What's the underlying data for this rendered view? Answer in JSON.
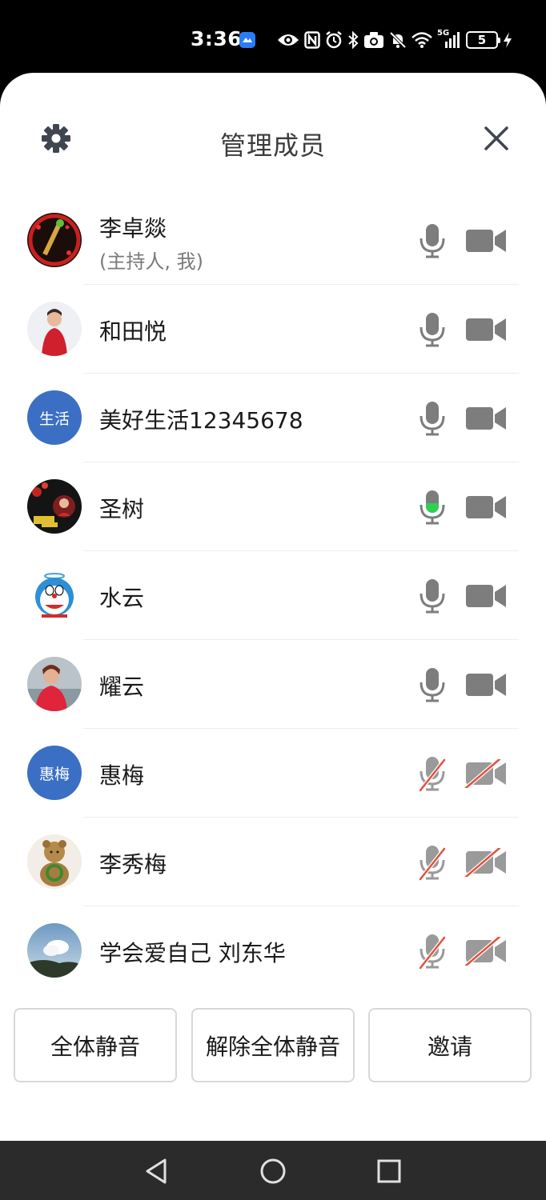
{
  "status_bar": {
    "time": "3:36",
    "network": "5G",
    "battery_level": "5",
    "icons": [
      "app-notification-icon",
      "eye-comfort-icon",
      "nfc-icon",
      "alarm-icon",
      "bluetooth-icon",
      "camera-icon",
      "mute-notification-icon",
      "wifi-icon",
      "signal-icon",
      "battery-icon",
      "charging-icon"
    ]
  },
  "header": {
    "title": "管理成员",
    "left_icon": "gear-icon",
    "right_icon": "close-icon"
  },
  "members": [
    {
      "name": "李卓燚",
      "role": "(主持人, 我)",
      "avatar": "photo",
      "mic": "on",
      "camera": "on"
    },
    {
      "name": "和田悦",
      "role": "",
      "avatar": "photo",
      "mic": "on",
      "camera": "on"
    },
    {
      "name": "美好生活12345678",
      "role": "",
      "avatar": "text",
      "avatar_text": "生活",
      "mic": "on",
      "camera": "on"
    },
    {
      "name": "圣树",
      "role": "",
      "avatar": "photo",
      "mic": "speaking",
      "camera": "on"
    },
    {
      "name": "水云",
      "role": "",
      "avatar": "photo",
      "mic": "on",
      "camera": "on"
    },
    {
      "name": "耀云",
      "role": "",
      "avatar": "photo",
      "mic": "on",
      "camera": "on"
    },
    {
      "name": "惠梅",
      "role": "",
      "avatar": "text",
      "avatar_text": "惠梅",
      "mic": "off",
      "camera": "off"
    },
    {
      "name": "李秀梅",
      "role": "",
      "avatar": "photo",
      "mic": "off",
      "camera": "off"
    },
    {
      "name": "学会爱自己 刘东华",
      "role": "",
      "avatar": "photo",
      "mic": "off",
      "camera": "off"
    }
  ],
  "actions": {
    "mute_all": "全体静音",
    "unmute_all": "解除全体静音",
    "invite": "邀请"
  },
  "nav_bar": {
    "icons": [
      "back-icon",
      "home-icon",
      "recents-icon"
    ]
  },
  "colors": {
    "accent_blue": "#3a6fc4",
    "icon_gray": "#7d7d7d",
    "muted_red": "#e0533d",
    "speaking_green": "#2bd14f"
  }
}
